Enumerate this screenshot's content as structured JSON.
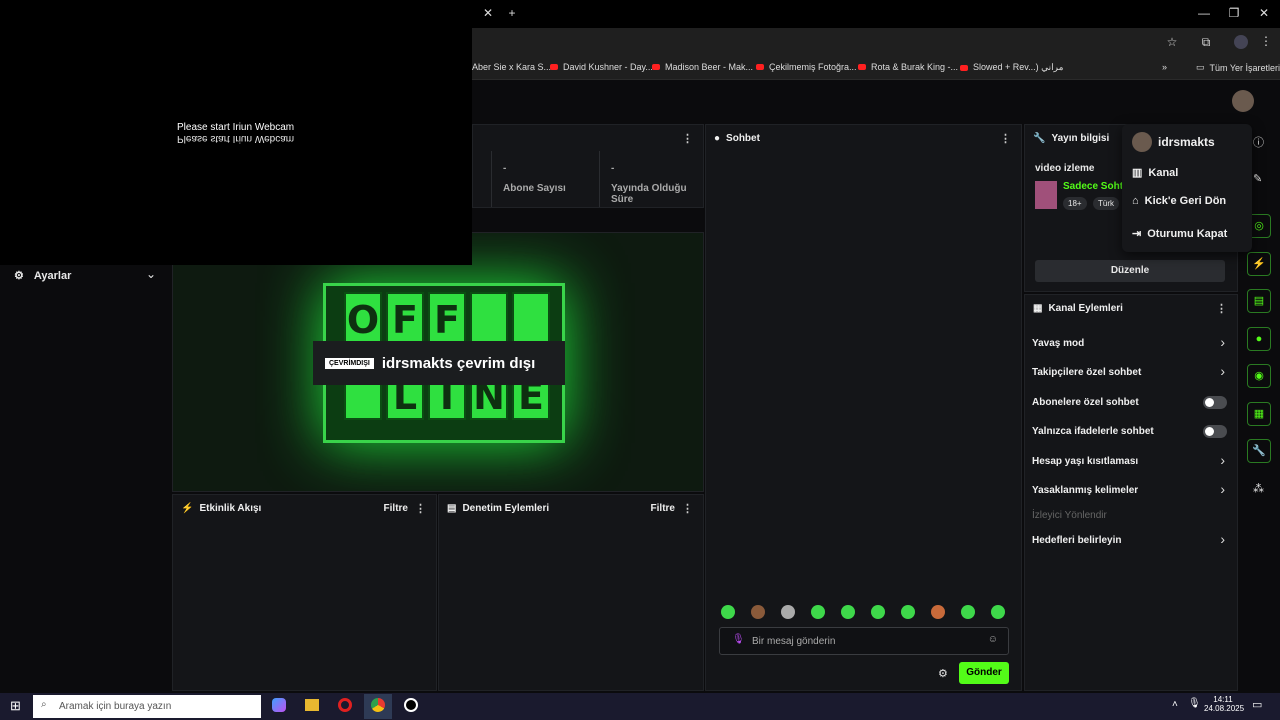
{
  "browser": {
    "bookmarks": [
      "Aber Sie x Kara S...",
      "David Kushner - Day...",
      "Madison Beer - Mak...",
      "Çekilmemiş Fotoğra...",
      "Rota & Burak King -...",
      "Slowed + Rev...) مراني"
    ],
    "all_bookmarks": "Tüm Yer İşaretleri"
  },
  "webcam": {
    "line1": "Please start Iriun Webcam",
    "line2": "Please start Iriun Webcam"
  },
  "sidebar": {
    "settings_label": "Ayarlar"
  },
  "stats": {
    "subscribers_value": "-",
    "subscribers_label": "Abone Sayısı",
    "live_value": "-",
    "live_label": "Yayında Olduğu Süre"
  },
  "player": {
    "badge": "ÇEVRİMDIŞI",
    "offline_text": "idrsmakts çevrim dışı",
    "sign_top": [
      "O",
      "F",
      "F",
      "",
      ""
    ],
    "sign_bottom": [
      "",
      "L",
      "I",
      "N",
      "E"
    ]
  },
  "activity": {
    "title": "Etkinlik Akışı",
    "filter": "Filtre"
  },
  "moderation": {
    "title": "Denetim Eylemleri",
    "filter": "Filtre"
  },
  "chat": {
    "title": "Sohbet",
    "placeholder": "Bir mesaj gönderin",
    "send": "Gönder"
  },
  "streaminfo": {
    "title": "Yayın bilgisi",
    "stream_title": "video izleme",
    "category": "Sadece Soht",
    "age_badge": "18+",
    "lang": "Türk",
    "edit": "Düzenle"
  },
  "actions": {
    "title": "Kanal Eylemleri",
    "items": [
      {
        "label": "Yavaş mod",
        "kind": "chevron"
      },
      {
        "label": "Takipçilere özel sohbet",
        "kind": "chevron"
      },
      {
        "label": "Abonelere özel sohbet",
        "kind": "toggle"
      },
      {
        "label": "Yalnızca ifadelerle sohbet",
        "kind": "toggle"
      },
      {
        "label": "Hesap yaşı kısıtlaması",
        "kind": "chevron"
      },
      {
        "label": "Yasaklanmış kelimeler",
        "kind": "chevron"
      }
    ],
    "muted": "İzleyici Yönlendir",
    "targets": "Hedefleri belirleyin"
  },
  "menu": {
    "username": "idrsmakts",
    "channel": "Kanal",
    "back": "Kick'e Geri Dön",
    "logout": "Oturumu Kapat"
  },
  "taskbar": {
    "search": "Aramak için buraya yazın",
    "time": "14:11",
    "date": "24.08.2025"
  },
  "colors": {
    "accent": "#53fc18",
    "bg": "#0b0b0d",
    "panel": "#141518"
  }
}
